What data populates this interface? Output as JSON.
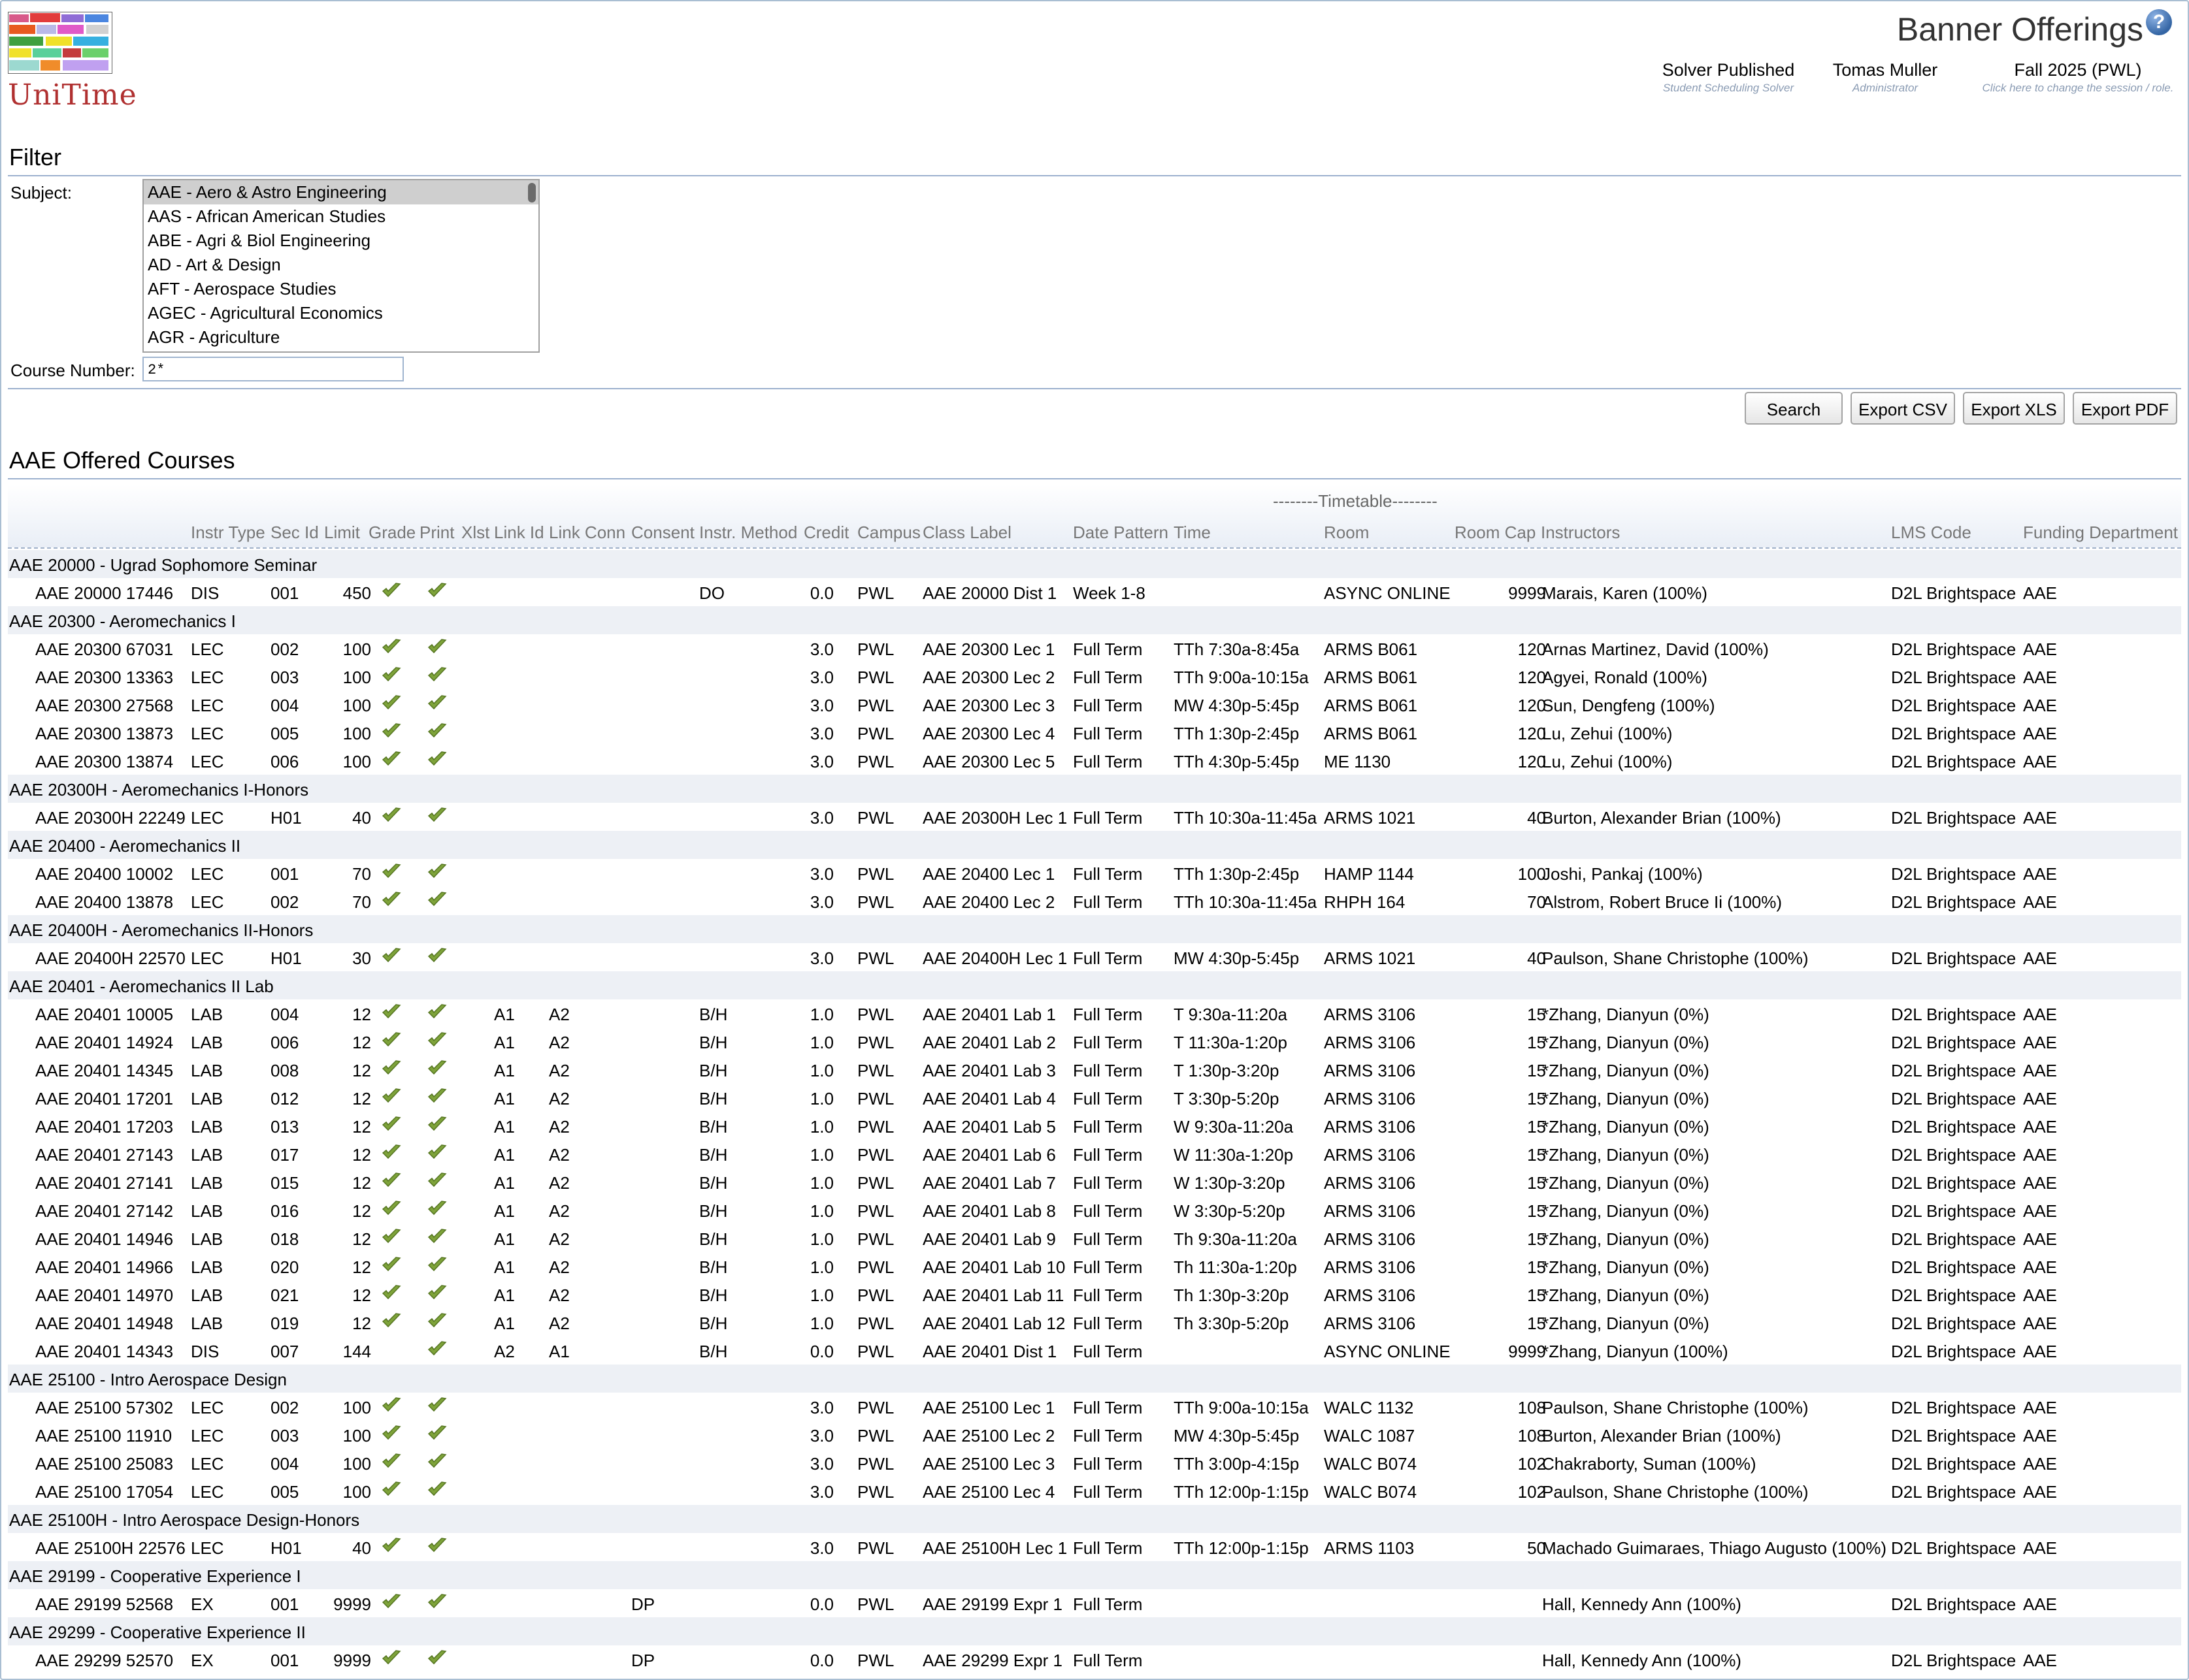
{
  "header": {
    "logo_text": "UniTime",
    "page_title": "Banner Offerings",
    "solver": {
      "main": "Solver Published",
      "sub": "Student Scheduling Solver"
    },
    "user": {
      "main": "Tomas Muller",
      "sub": "Administrator"
    },
    "session": {
      "main": "Fall 2025 (PWL)",
      "sub": "Click here to change the session / role."
    }
  },
  "filter": {
    "title": "Filter",
    "subject_label": "Subject:",
    "subjects": [
      "AAE - Aero & Astro Engineering",
      "AAS - African American Studies",
      "ABE - Agri & Biol Engineering",
      "AD - Art & Design",
      "AFT - Aerospace Studies",
      "AGEC - Agricultural Economics",
      "AGR - Agriculture"
    ],
    "course_number_label": "Course Number:",
    "course_number_value": "2*"
  },
  "buttons": {
    "search": "Search",
    "export_csv": "Export CSV",
    "export_xls": "Export XLS",
    "export_pdf": "Export PDF"
  },
  "table": {
    "title": "AAE Offered Courses",
    "timetable_header": "--------Timetable--------",
    "columns": [
      "Instr Type",
      "Sec Id",
      "Limit",
      "Grade",
      "Print",
      "Xlst",
      "Link Id",
      "Link Conn",
      "Consent",
      "Instr. Method",
      "Credit",
      "Campus",
      "Class Label",
      "Date Pattern",
      "Time",
      "Room",
      "Room Cap",
      "Instructors",
      "LMS Code",
      "Funding Department"
    ],
    "rows": [
      {
        "course": "AAE 20000 - Ugrad Sophomore Seminar"
      },
      {
        "id": "AAE 20000 17446",
        "type": "DIS",
        "sec": "001",
        "limit": "450",
        "grade": true,
        "print": true,
        "link": "",
        "conn": "",
        "consent": "",
        "method": "DO",
        "credit": "0.0",
        "campus": "PWL",
        "label": "AAE 20000 Dist 1",
        "dp": "Week 1-8",
        "time": "",
        "room": "ASYNC ONLINE",
        "cap": "9999",
        "instr": "Marais, Karen (100%)",
        "lms": "D2L Brightspace",
        "fund": "AAE"
      },
      {
        "course": "AAE 20300 - Aeromechanics I"
      },
      {
        "id": "AAE 20300 67031",
        "type": "LEC",
        "sec": "002",
        "limit": "100",
        "grade": true,
        "print": true,
        "link": "",
        "conn": "",
        "consent": "",
        "method": "",
        "credit": "3.0",
        "campus": "PWL",
        "label": "AAE 20300 Lec 1",
        "dp": "Full Term",
        "time": "TTh 7:30a-8:45a",
        "room": "ARMS B061",
        "cap": "120",
        "instr": "Arnas Martinez, David (100%)",
        "lms": "D2L Brightspace",
        "fund": "AAE"
      },
      {
        "id": "AAE 20300 13363",
        "type": "LEC",
        "sec": "003",
        "limit": "100",
        "grade": true,
        "print": true,
        "link": "",
        "conn": "",
        "consent": "",
        "method": "",
        "credit": "3.0",
        "campus": "PWL",
        "label": "AAE 20300 Lec 2",
        "dp": "Full Term",
        "time": "TTh 9:00a-10:15a",
        "room": "ARMS B061",
        "cap": "120",
        "instr": "Agyei, Ronald (100%)",
        "lms": "D2L Brightspace",
        "fund": "AAE"
      },
      {
        "id": "AAE 20300 27568",
        "type": "LEC",
        "sec": "004",
        "limit": "100",
        "grade": true,
        "print": true,
        "link": "",
        "conn": "",
        "consent": "",
        "method": "",
        "credit": "3.0",
        "campus": "PWL",
        "label": "AAE 20300 Lec 3",
        "dp": "Full Term",
        "time": "MW 4:30p-5:45p",
        "room": "ARMS B061",
        "cap": "120",
        "instr": "Sun, Dengfeng (100%)",
        "lms": "D2L Brightspace",
        "fund": "AAE"
      },
      {
        "id": "AAE 20300 13873",
        "type": "LEC",
        "sec": "005",
        "limit": "100",
        "grade": true,
        "print": true,
        "link": "",
        "conn": "",
        "consent": "",
        "method": "",
        "credit": "3.0",
        "campus": "PWL",
        "label": "AAE 20300 Lec 4",
        "dp": "Full Term",
        "time": "TTh 1:30p-2:45p",
        "room": "ARMS B061",
        "cap": "120",
        "instr": "Lu, Zehui (100%)",
        "lms": "D2L Brightspace",
        "fund": "AAE"
      },
      {
        "id": "AAE 20300 13874",
        "type": "LEC",
        "sec": "006",
        "limit": "100",
        "grade": true,
        "print": true,
        "link": "",
        "conn": "",
        "consent": "",
        "method": "",
        "credit": "3.0",
        "campus": "PWL",
        "label": "AAE 20300 Lec 5",
        "dp": "Full Term",
        "time": "TTh 4:30p-5:45p",
        "room": "ME 1130",
        "cap": "120",
        "instr": "Lu, Zehui (100%)",
        "lms": "D2L Brightspace",
        "fund": "AAE"
      },
      {
        "course": "AAE 20300H - Aeromechanics I-Honors"
      },
      {
        "id": "AAE 20300H 22249",
        "type": "LEC",
        "sec": "H01",
        "limit": "40",
        "grade": true,
        "print": true,
        "link": "",
        "conn": "",
        "consent": "",
        "method": "",
        "credit": "3.0",
        "campus": "PWL",
        "label": "AAE 20300H Lec 1",
        "dp": "Full Term",
        "time": "TTh 10:30a-11:45a",
        "room": "ARMS 1021",
        "cap": "40",
        "instr": "Burton, Alexander Brian (100%)",
        "lms": "D2L Brightspace",
        "fund": "AAE"
      },
      {
        "course": "AAE 20400 - Aeromechanics II"
      },
      {
        "id": "AAE 20400 10002",
        "type": "LEC",
        "sec": "001",
        "limit": "70",
        "grade": true,
        "print": true,
        "link": "",
        "conn": "",
        "consent": "",
        "method": "",
        "credit": "3.0",
        "campus": "PWL",
        "label": "AAE 20400 Lec 1",
        "dp": "Full Term",
        "time": "TTh 1:30p-2:45p",
        "room": "HAMP 1144",
        "cap": "100",
        "instr": "Joshi, Pankaj (100%)",
        "lms": "D2L Brightspace",
        "fund": "AAE"
      },
      {
        "id": "AAE 20400 13878",
        "type": "LEC",
        "sec": "002",
        "limit": "70",
        "grade": true,
        "print": true,
        "link": "",
        "conn": "",
        "consent": "",
        "method": "",
        "credit": "3.0",
        "campus": "PWL",
        "label": "AAE 20400 Lec 2",
        "dp": "Full Term",
        "time": "TTh 10:30a-11:45a",
        "room": "RHPH 164",
        "cap": "70",
        "instr": "Alstrom, Robert Bruce Ii (100%)",
        "lms": "D2L Brightspace",
        "fund": "AAE"
      },
      {
        "course": "AAE 20400H - Aeromechanics II-Honors"
      },
      {
        "id": "AAE 20400H 22570",
        "type": "LEC",
        "sec": "H01",
        "limit": "30",
        "grade": true,
        "print": true,
        "link": "",
        "conn": "",
        "consent": "",
        "method": "",
        "credit": "3.0",
        "campus": "PWL",
        "label": "AAE 20400H Lec 1",
        "dp": "Full Term",
        "time": "MW 4:30p-5:45p",
        "room": "ARMS 1021",
        "cap": "40",
        "instr": "Paulson, Shane Christophe (100%)",
        "lms": "D2L Brightspace",
        "fund": "AAE"
      },
      {
        "course": "AAE 20401 - Aeromechanics II Lab"
      },
      {
        "id": "AAE 20401 10005",
        "type": "LAB",
        "sec": "004",
        "limit": "12",
        "grade": true,
        "print": true,
        "link": "A1",
        "conn": "A2",
        "consent": "",
        "method": "B/H",
        "credit": "1.0",
        "campus": "PWL",
        "label": "AAE 20401 Lab 1",
        "dp": "Full Term",
        "time": "T 9:30a-11:20a",
        "room": "ARMS 3106",
        "cap": "15",
        "instr": "*Zhang, Dianyun (0%)",
        "lms": "D2L Brightspace",
        "fund": "AAE"
      },
      {
        "id": "AAE 20401 14924",
        "type": "LAB",
        "sec": "006",
        "limit": "12",
        "grade": true,
        "print": true,
        "link": "A1",
        "conn": "A2",
        "consent": "",
        "method": "B/H",
        "credit": "1.0",
        "campus": "PWL",
        "label": "AAE 20401 Lab 2",
        "dp": "Full Term",
        "time": "T 11:30a-1:20p",
        "room": "ARMS 3106",
        "cap": "15",
        "instr": "*Zhang, Dianyun (0%)",
        "lms": "D2L Brightspace",
        "fund": "AAE"
      },
      {
        "id": "AAE 20401 14345",
        "type": "LAB",
        "sec": "008",
        "limit": "12",
        "grade": true,
        "print": true,
        "link": "A1",
        "conn": "A2",
        "consent": "",
        "method": "B/H",
        "credit": "1.0",
        "campus": "PWL",
        "label": "AAE 20401 Lab 3",
        "dp": "Full Term",
        "time": "T 1:30p-3:20p",
        "room": "ARMS 3106",
        "cap": "15",
        "instr": "*Zhang, Dianyun (0%)",
        "lms": "D2L Brightspace",
        "fund": "AAE"
      },
      {
        "id": "AAE 20401 17201",
        "type": "LAB",
        "sec": "012",
        "limit": "12",
        "grade": true,
        "print": true,
        "link": "A1",
        "conn": "A2",
        "consent": "",
        "method": "B/H",
        "credit": "1.0",
        "campus": "PWL",
        "label": "AAE 20401 Lab 4",
        "dp": "Full Term",
        "time": "T 3:30p-5:20p",
        "room": "ARMS 3106",
        "cap": "15",
        "instr": "*Zhang, Dianyun (0%)",
        "lms": "D2L Brightspace",
        "fund": "AAE"
      },
      {
        "id": "AAE 20401 17203",
        "type": "LAB",
        "sec": "013",
        "limit": "12",
        "grade": true,
        "print": true,
        "link": "A1",
        "conn": "A2",
        "consent": "",
        "method": "B/H",
        "credit": "1.0",
        "campus": "PWL",
        "label": "AAE 20401 Lab 5",
        "dp": "Full Term",
        "time": "W 9:30a-11:20a",
        "room": "ARMS 3106",
        "cap": "15",
        "instr": "*Zhang, Dianyun (0%)",
        "lms": "D2L Brightspace",
        "fund": "AAE"
      },
      {
        "id": "AAE 20401 27143",
        "type": "LAB",
        "sec": "017",
        "limit": "12",
        "grade": true,
        "print": true,
        "link": "A1",
        "conn": "A2",
        "consent": "",
        "method": "B/H",
        "credit": "1.0",
        "campus": "PWL",
        "label": "AAE 20401 Lab 6",
        "dp": "Full Term",
        "time": "W 11:30a-1:20p",
        "room": "ARMS 3106",
        "cap": "15",
        "instr": "*Zhang, Dianyun (0%)",
        "lms": "D2L Brightspace",
        "fund": "AAE"
      },
      {
        "id": "AAE 20401 27141",
        "type": "LAB",
        "sec": "015",
        "limit": "12",
        "grade": true,
        "print": true,
        "link": "A1",
        "conn": "A2",
        "consent": "",
        "method": "B/H",
        "credit": "1.0",
        "campus": "PWL",
        "label": "AAE 20401 Lab 7",
        "dp": "Full Term",
        "time": "W 1:30p-3:20p",
        "room": "ARMS 3106",
        "cap": "15",
        "instr": "*Zhang, Dianyun (0%)",
        "lms": "D2L Brightspace",
        "fund": "AAE"
      },
      {
        "id": "AAE 20401 27142",
        "type": "LAB",
        "sec": "016",
        "limit": "12",
        "grade": true,
        "print": true,
        "link": "A1",
        "conn": "A2",
        "consent": "",
        "method": "B/H",
        "credit": "1.0",
        "campus": "PWL",
        "label": "AAE 20401 Lab 8",
        "dp": "Full Term",
        "time": "W 3:30p-5:20p",
        "room": "ARMS 3106",
        "cap": "15",
        "instr": "*Zhang, Dianyun (0%)",
        "lms": "D2L Brightspace",
        "fund": "AAE"
      },
      {
        "id": "AAE 20401 14946",
        "type": "LAB",
        "sec": "018",
        "limit": "12",
        "grade": true,
        "print": true,
        "link": "A1",
        "conn": "A2",
        "consent": "",
        "method": "B/H",
        "credit": "1.0",
        "campus": "PWL",
        "label": "AAE 20401 Lab 9",
        "dp": "Full Term",
        "time": "Th 9:30a-11:20a",
        "room": "ARMS 3106",
        "cap": "15",
        "instr": "*Zhang, Dianyun (0%)",
        "lms": "D2L Brightspace",
        "fund": "AAE"
      },
      {
        "id": "AAE 20401 14966",
        "type": "LAB",
        "sec": "020",
        "limit": "12",
        "grade": true,
        "print": true,
        "link": "A1",
        "conn": "A2",
        "consent": "",
        "method": "B/H",
        "credit": "1.0",
        "campus": "PWL",
        "label": "AAE 20401 Lab 10",
        "dp": "Full Term",
        "time": "Th 11:30a-1:20p",
        "room": "ARMS 3106",
        "cap": "15",
        "instr": "*Zhang, Dianyun (0%)",
        "lms": "D2L Brightspace",
        "fund": "AAE"
      },
      {
        "id": "AAE 20401 14970",
        "type": "LAB",
        "sec": "021",
        "limit": "12",
        "grade": true,
        "print": true,
        "link": "A1",
        "conn": "A2",
        "consent": "",
        "method": "B/H",
        "credit": "1.0",
        "campus": "PWL",
        "label": "AAE 20401 Lab 11",
        "dp": "Full Term",
        "time": "Th 1:30p-3:20p",
        "room": "ARMS 3106",
        "cap": "15",
        "instr": "*Zhang, Dianyun (0%)",
        "lms": "D2L Brightspace",
        "fund": "AAE"
      },
      {
        "id": "AAE 20401 14948",
        "type": "LAB",
        "sec": "019",
        "limit": "12",
        "grade": true,
        "print": true,
        "link": "A1",
        "conn": "A2",
        "consent": "",
        "method": "B/H",
        "credit": "1.0",
        "campus": "PWL",
        "label": "AAE 20401 Lab 12",
        "dp": "Full Term",
        "time": "Th 3:30p-5:20p",
        "room": "ARMS 3106",
        "cap": "15",
        "instr": "*Zhang, Dianyun (0%)",
        "lms": "D2L Brightspace",
        "fund": "AAE"
      },
      {
        "id": "AAE 20401 14343",
        "type": "DIS",
        "sec": "007",
        "limit": "144",
        "grade": false,
        "print": true,
        "link": "A2",
        "conn": "A1",
        "consent": "",
        "method": "B/H",
        "credit": "0.0",
        "campus": "PWL",
        "label": "AAE 20401 Dist 1",
        "dp": "Full Term",
        "time": "",
        "room": "ASYNC ONLINE",
        "cap": "9999",
        "instr": "*Zhang, Dianyun (100%)",
        "lms": "D2L Brightspace",
        "fund": "AAE"
      },
      {
        "course": "AAE 25100 - Intro Aerospace Design"
      },
      {
        "id": "AAE 25100 57302",
        "type": "LEC",
        "sec": "002",
        "limit": "100",
        "grade": true,
        "print": true,
        "link": "",
        "conn": "",
        "consent": "",
        "method": "",
        "credit": "3.0",
        "campus": "PWL",
        "label": "AAE 25100 Lec 1",
        "dp": "Full Term",
        "time": "TTh 9:00a-10:15a",
        "room": "WALC 1132",
        "cap": "108",
        "instr": "Paulson, Shane Christophe (100%)",
        "lms": "D2L Brightspace",
        "fund": "AAE"
      },
      {
        "id": "AAE 25100 11910",
        "type": "LEC",
        "sec": "003",
        "limit": "100",
        "grade": true,
        "print": true,
        "link": "",
        "conn": "",
        "consent": "",
        "method": "",
        "credit": "3.0",
        "campus": "PWL",
        "label": "AAE 25100 Lec 2",
        "dp": "Full Term",
        "time": "MW 4:30p-5:45p",
        "room": "WALC 1087",
        "cap": "108",
        "instr": "Burton, Alexander Brian (100%)",
        "lms": "D2L Brightspace",
        "fund": "AAE"
      },
      {
        "id": "AAE 25100 25083",
        "type": "LEC",
        "sec": "004",
        "limit": "100",
        "grade": true,
        "print": true,
        "link": "",
        "conn": "",
        "consent": "",
        "method": "",
        "credit": "3.0",
        "campus": "PWL",
        "label": "AAE 25100 Lec 3",
        "dp": "Full Term",
        "time": "TTh 3:00p-4:15p",
        "room": "WALC B074",
        "cap": "102",
        "instr": "Chakraborty, Suman (100%)",
        "lms": "D2L Brightspace",
        "fund": "AAE"
      },
      {
        "id": "AAE 25100 17054",
        "type": "LEC",
        "sec": "005",
        "limit": "100",
        "grade": true,
        "print": true,
        "link": "",
        "conn": "",
        "consent": "",
        "method": "",
        "credit": "3.0",
        "campus": "PWL",
        "label": "AAE 25100 Lec 4",
        "dp": "Full Term",
        "time": "TTh 12:00p-1:15p",
        "room": "WALC B074",
        "cap": "102",
        "instr": "Paulson, Shane Christophe (100%)",
        "lms": "D2L Brightspace",
        "fund": "AAE"
      },
      {
        "course": "AAE 25100H - Intro Aerospace Design-Honors"
      },
      {
        "id": "AAE 25100H 22576",
        "type": "LEC",
        "sec": "H01",
        "limit": "40",
        "grade": true,
        "print": true,
        "link": "",
        "conn": "",
        "consent": "",
        "method": "",
        "credit": "3.0",
        "campus": "PWL",
        "label": "AAE 25100H Lec 1",
        "dp": "Full Term",
        "time": "TTh 12:00p-1:15p",
        "room": "ARMS 1103",
        "cap": "50",
        "instr": "Machado Guimaraes, Thiago Augusto (100%)",
        "lms": "D2L Brightspace",
        "fund": "AAE"
      },
      {
        "course": "AAE 29199 - Cooperative Experience I"
      },
      {
        "id": "AAE 29199 52568",
        "type": "EX",
        "sec": "001",
        "limit": "9999",
        "grade": true,
        "print": true,
        "link": "",
        "conn": "",
        "consent": "DP",
        "method": "",
        "credit": "0.0",
        "campus": "PWL",
        "label": "AAE 29199 Expr 1",
        "dp": "Full Term",
        "time": "",
        "room": "",
        "cap": "",
        "instr": "Hall, Kennedy Ann (100%)",
        "lms": "D2L Brightspace",
        "fund": "AAE"
      },
      {
        "course": "AAE 29299 - Cooperative Experience II"
      },
      {
        "id": "AAE 29299 52570",
        "type": "EX",
        "sec": "001",
        "limit": "9999",
        "grade": true,
        "print": true,
        "link": "",
        "conn": "",
        "consent": "DP",
        "method": "",
        "credit": "0.0",
        "campus": "PWL",
        "label": "AAE 29299 Expr 1",
        "dp": "Full Term",
        "time": "",
        "room": "",
        "cap": "",
        "instr": "Hall, Kennedy Ann (100%)",
        "lms": "D2L Brightspace",
        "fund": "AAE"
      }
    ]
  }
}
